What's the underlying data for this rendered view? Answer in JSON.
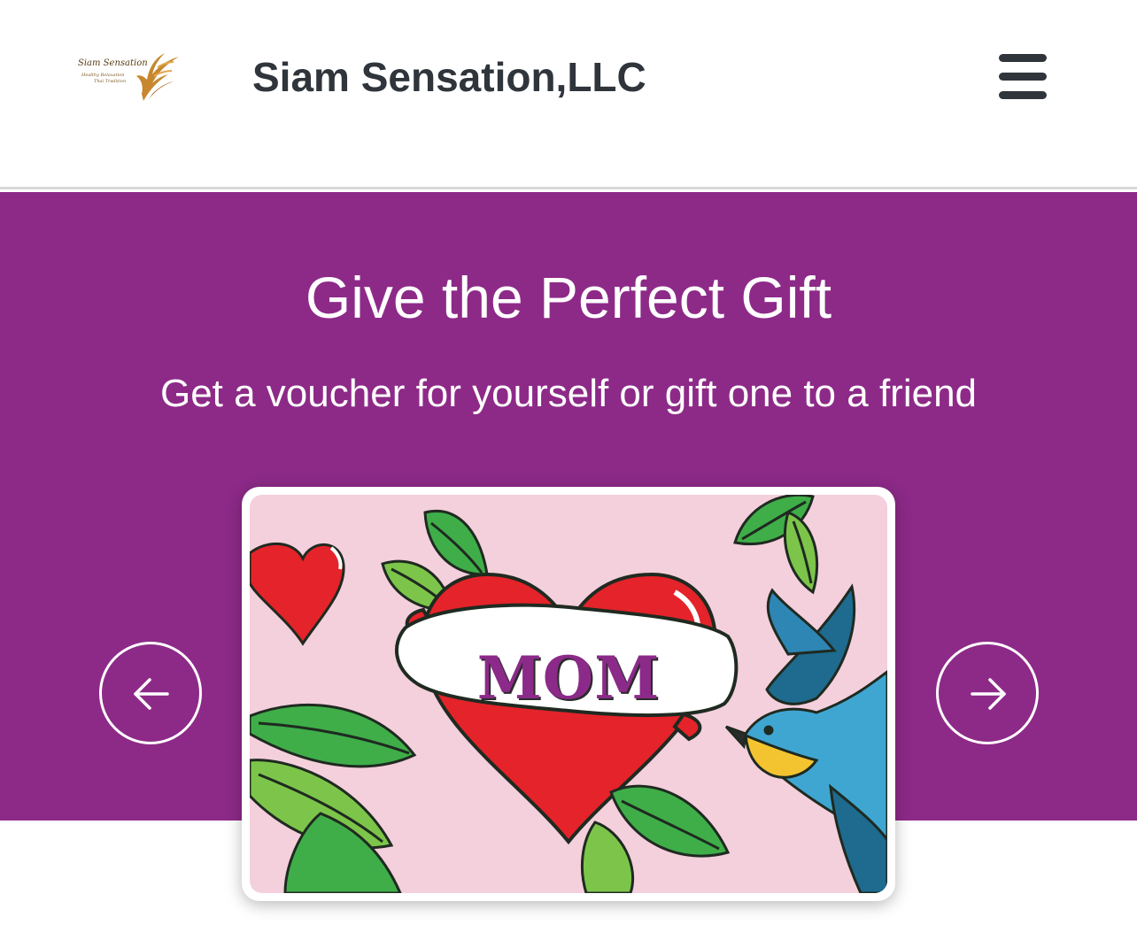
{
  "header": {
    "logo": {
      "name": "Siam Sensation",
      "tagline_line1": "Healthy Relaxation",
      "tagline_line2": "Thai Tradition",
      "icon": "siam-sensation-logo"
    },
    "business_name": "Siam Sensation,LLC",
    "menu_icon": "hamburger-menu-icon"
  },
  "hero": {
    "title": "Give the Perfect Gift",
    "subtitle": "Get a voucher for yourself or gift one to a friend",
    "background_color": "#8d2a88"
  },
  "carousel": {
    "prev_icon": "arrow-left-icon",
    "next_icon": "arrow-right-icon",
    "card": {
      "banner_text": "MOM",
      "design": "heart tattoo with leaves and bird",
      "background_color": "#f4cfdc"
    }
  },
  "colors": {
    "text_dark": "#2f353b",
    "heart_red": "#e4232a",
    "leaf_green": "#4caf3f",
    "bird_blue": "#2e86b5"
  }
}
